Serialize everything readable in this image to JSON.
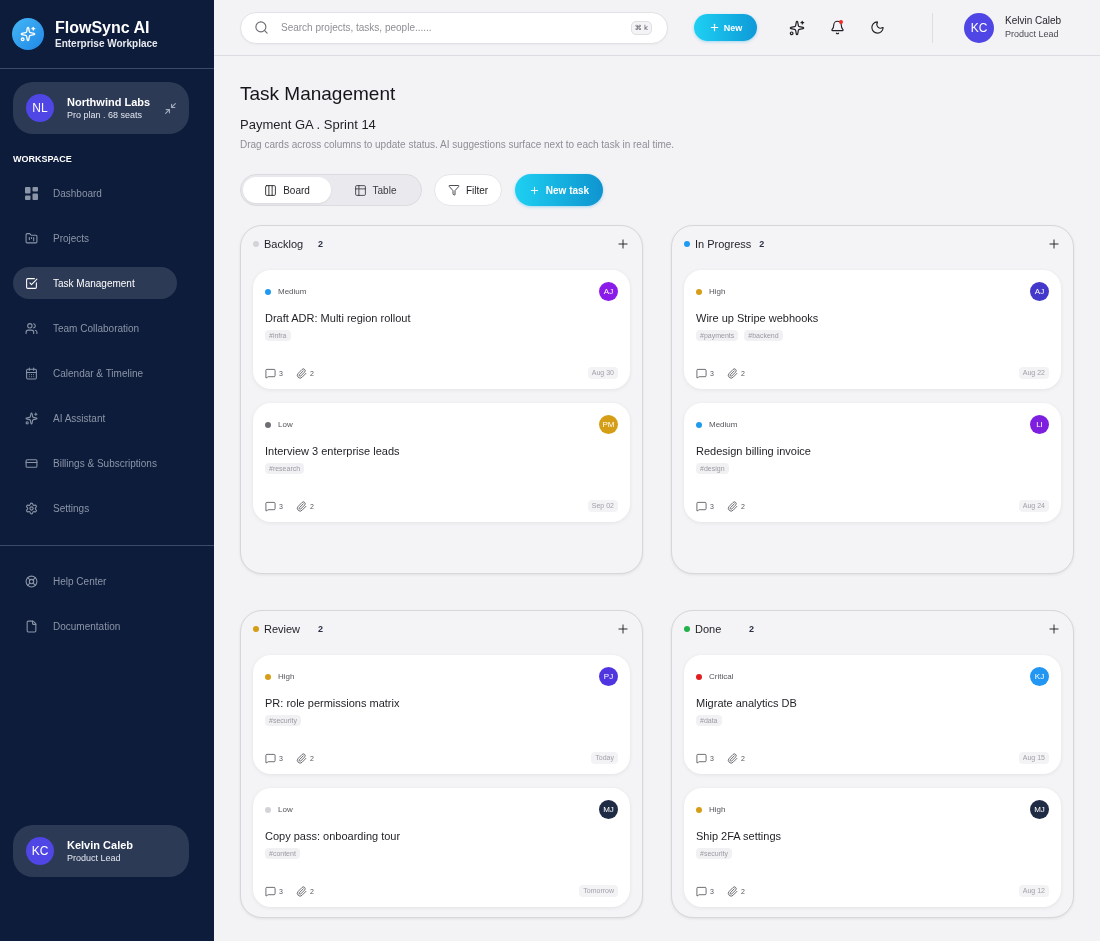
{
  "sidebar": {
    "brand": {
      "name": "FlowSync AI",
      "subtitle": "Enterprise Workplace"
    },
    "org": {
      "initials": "NL",
      "name": "Northwind Labs",
      "plan": "Pro plan . 68 seats"
    },
    "section_label": "WORKSPACE",
    "items": [
      {
        "label": "Dashboard",
        "selected": false
      },
      {
        "label": "Projects",
        "selected": false
      },
      {
        "label": "Task Management",
        "selected": true
      },
      {
        "label": "Team Collaboration",
        "selected": false
      },
      {
        "label": "Calendar & Timeline",
        "selected": false
      },
      {
        "label": "AI Assistant",
        "selected": false
      },
      {
        "label": "Billings & Subscriptions",
        "selected": false
      },
      {
        "label": "Settings",
        "selected": false
      }
    ],
    "footer_items": [
      {
        "label": "Help Center",
        "selected": false
      },
      {
        "label": "Documentation",
        "selected": false
      }
    ],
    "user": {
      "initials": "KC",
      "name": "Kelvin Caleb",
      "role": "Product Lead"
    }
  },
  "header": {
    "search": {
      "placeholder": "Search projects, tasks, people......",
      "shortcut": "⌘ k"
    },
    "new_button": "New",
    "notifications": {
      "unread": true
    },
    "user": {
      "initials": "KC",
      "name": "Kelvin Caleb",
      "role": "Product Lead"
    }
  },
  "page": {
    "title": "Task Management",
    "subtitle": "Payment GA . Sprint 14",
    "description": "Drag cards across columns to update status. AI suggestions surface next to each task in real time."
  },
  "toolbar": {
    "views": [
      {
        "label": "Board",
        "selected": true
      },
      {
        "label": "Table",
        "selected": false
      }
    ],
    "filter": "Filter",
    "new_task": "New task"
  },
  "columns": [
    {
      "title": "Backlog",
      "count": "2",
      "color": "#d4d4d8",
      "cards": [
        {
          "priority": {
            "label": "Medium",
            "color": "#1e9bf0"
          },
          "title": "Draft ADR: Multi region rollout",
          "tags": [
            "#infra"
          ],
          "comments": "3",
          "attachments": "2",
          "due": "Aug 30",
          "assignee": {
            "initials": "AJ",
            "color": "#8a1be8"
          }
        },
        {
          "priority": {
            "label": "Low",
            "color": "#6e6e74"
          },
          "title": "Interview 3 enterprise leads",
          "tags": [
            "#research"
          ],
          "comments": "3",
          "attachments": "2",
          "due": "Sep 02",
          "assignee": {
            "initials": "PM",
            "color": "#d69e16"
          }
        }
      ]
    },
    {
      "title": "In Progress",
      "count": "2",
      "color": "#1e9bf0",
      "cards": [
        {
          "priority": {
            "label": "High",
            "color": "#d69e16"
          },
          "title": "Wire up Stripe webhooks",
          "tags": [
            "#payments",
            "#backend"
          ],
          "comments": "3",
          "attachments": "2",
          "due": "Aug 22",
          "assignee": {
            "initials": "AJ",
            "color": "#4338ca"
          }
        },
        {
          "priority": {
            "label": "Medium",
            "color": "#1e9bf0"
          },
          "title": "Redesign billing invoice",
          "tags": [
            "#design"
          ],
          "comments": "3",
          "attachments": "2",
          "due": "Aug 24",
          "assignee": {
            "initials": "LI",
            "color": "#7e1fe0"
          }
        }
      ]
    },
    {
      "title": "Review",
      "count": "2",
      "color": "#d69e16",
      "cards": [
        {
          "priority": {
            "label": "High",
            "color": "#d69e16"
          },
          "title": "PR: role permissions matrix",
          "tags": [
            "#security"
          ],
          "comments": "3",
          "attachments": "2",
          "due": "Today",
          "assignee": {
            "initials": "PJ",
            "color": "#4f35e0"
          }
        },
        {
          "priority": {
            "label": "Low",
            "color": "#d4d4d8"
          },
          "title": "Copy pass: onboarding tour",
          "tags": [
            "#content"
          ],
          "comments": "3",
          "attachments": "2",
          "due": "Tomorrow",
          "assignee": {
            "initials": "MJ",
            "color": "#1f2a44"
          }
        }
      ]
    },
    {
      "title": "Done",
      "count": "2",
      "color": "#22b14c",
      "cards": [
        {
          "priority": {
            "label": "Critical",
            "color": "#e11d1d"
          },
          "title": "Migrate analytics DB",
          "tags": [
            "#data"
          ],
          "comments": "3",
          "attachments": "2",
          "due": "Aug 15",
          "assignee": {
            "initials": "KJ",
            "color": "#2196f3"
          }
        },
        {
          "priority": {
            "label": "High",
            "color": "#d69e16"
          },
          "title": "Ship 2FA settings",
          "tags": [
            "#security"
          ],
          "comments": "3",
          "attachments": "2",
          "due": "Aug 12",
          "assignee": {
            "initials": "MJ",
            "color": "#1f2a44"
          }
        }
      ]
    }
  ]
}
